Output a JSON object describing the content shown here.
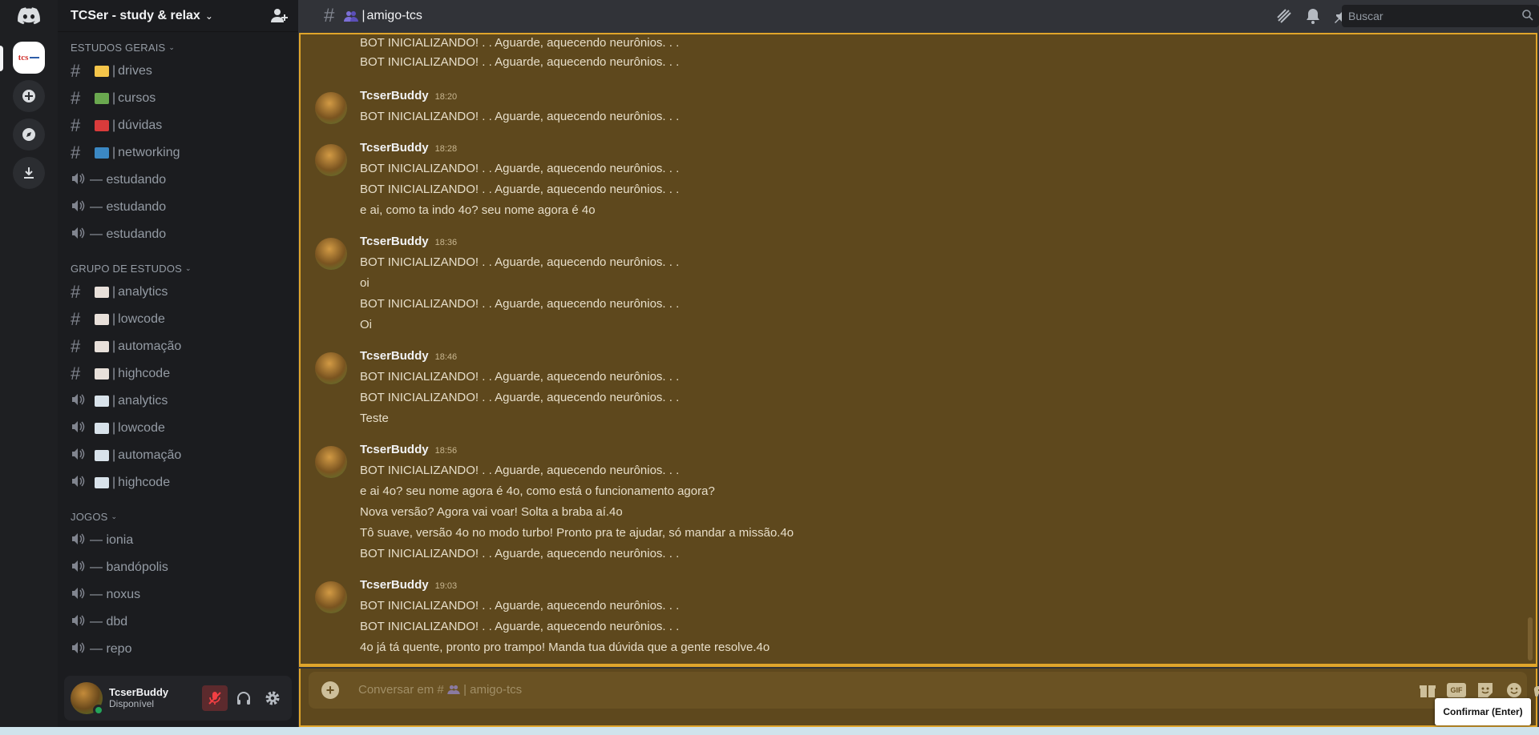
{
  "server": {
    "name": "TCSer - study & relax",
    "icon_text": "tcs"
  },
  "categories": [
    {
      "label": "ESTUDOS GERAIS",
      "channels": [
        {
          "type": "text",
          "emoji_color": "#f4c54a",
          "label": "drives"
        },
        {
          "type": "text",
          "emoji_color": "#6aa84f",
          "label": "cursos"
        },
        {
          "type": "text",
          "emoji_color": "#d93b3b",
          "label": "dúvidas"
        },
        {
          "type": "text",
          "emoji_color": "#3b88c3",
          "label": "networking"
        },
        {
          "type": "voice",
          "label": "— estudando"
        },
        {
          "type": "voice",
          "label": "— estudando"
        },
        {
          "type": "voice",
          "label": "— estudando"
        }
      ]
    },
    {
      "label": "GRUPO DE ESTUDOS",
      "channels": [
        {
          "type": "text",
          "emoji_color": "#e8e0da",
          "label": "analytics"
        },
        {
          "type": "text",
          "emoji_color": "#e8e0da",
          "label": "lowcode"
        },
        {
          "type": "text",
          "emoji_color": "#e8e0da",
          "label": "automação"
        },
        {
          "type": "text",
          "emoji_color": "#e8e0da",
          "label": "highcode"
        },
        {
          "type": "voice-book",
          "emoji_color": "#d8e2ea",
          "label": "analytics"
        },
        {
          "type": "voice-book",
          "emoji_color": "#d8e2ea",
          "label": "lowcode"
        },
        {
          "type": "voice-book",
          "emoji_color": "#d8e2ea",
          "label": "automação"
        },
        {
          "type": "voice-book",
          "emoji_color": "#d8e2ea",
          "label": "highcode"
        }
      ]
    },
    {
      "label": "JOGOS",
      "channels": [
        {
          "type": "voice",
          "label": "— ionia"
        },
        {
          "type": "voice",
          "label": "— bandópolis"
        },
        {
          "type": "voice",
          "label": "— noxus"
        },
        {
          "type": "voice",
          "label": "— dbd"
        },
        {
          "type": "voice",
          "label": "— repo"
        }
      ]
    }
  ],
  "user": {
    "name": "TcserBuddy",
    "status": "Disponível"
  },
  "channel_header": {
    "title": "amigo-tcs",
    "search_placeholder": "Buscar"
  },
  "messages": {
    "orphan_lines": [
      "BOT INICIALIZANDO! . . Aguarde, aquecendo neurônios. . .",
      "BOT INICIALIZANDO! . . Aguarde, aquecendo neurônios. . ."
    ],
    "groups": [
      {
        "author": "TcserBuddy",
        "time": "18:20",
        "lines": [
          "BOT INICIALIZANDO! . . Aguarde, aquecendo neurônios. . ."
        ]
      },
      {
        "author": "TcserBuddy",
        "time": "18:28",
        "lines": [
          "BOT INICIALIZANDO! . . Aguarde, aquecendo neurônios. . .",
          "BOT INICIALIZANDO! . . Aguarde, aquecendo neurônios. . .",
          "e ai, como ta indo 4o? seu nome agora é 4o"
        ]
      },
      {
        "author": "TcserBuddy",
        "time": "18:36",
        "lines": [
          "BOT INICIALIZANDO! . . Aguarde, aquecendo neurônios. . .",
          "oi",
          "BOT INICIALIZANDO! . . Aguarde, aquecendo neurônios. . .",
          "Oi"
        ]
      },
      {
        "author": "TcserBuddy",
        "time": "18:46",
        "lines": [
          "BOT INICIALIZANDO! . . Aguarde, aquecendo neurônios. . .",
          "BOT INICIALIZANDO! . . Aguarde, aquecendo neurônios. . .",
          "Teste"
        ]
      },
      {
        "author": "TcserBuddy",
        "time": "18:56",
        "lines": [
          "BOT INICIALIZANDO! . . Aguarde, aquecendo neurônios. . .",
          "e ai 4o? seu nome agora é 4o, como está o funcionamento agora?",
          "Nova versão? Agora vai voar! Solta a braba aí.4o",
          "Tô suave, versão 4o no modo turbo! Pronto pra te ajudar, só mandar a missão.4o",
          "BOT INICIALIZANDO! . . Aguarde, aquecendo neurônios. . ."
        ]
      },
      {
        "author": "TcserBuddy",
        "time": "19:03",
        "lines": [
          "BOT INICIALIZANDO! . . Aguarde, aquecendo neurônios. . .",
          "BOT INICIALIZANDO! . . Aguarde, aquecendo neurônios. . .",
          "4o já tá quente, pronto pro trampo! Manda tua dúvida que a gente resolve.4o"
        ]
      }
    ]
  },
  "composer": {
    "placeholder_prefix": "Conversar em #",
    "placeholder_channel": "amigo-tcs",
    "gif_label": "GIF"
  },
  "tooltip": {
    "label": "Confirmar (Enter)"
  },
  "colors": {
    "highlight_border": "#e0a52b",
    "chat_bg": "#5e481d",
    "online": "#23a55a"
  }
}
